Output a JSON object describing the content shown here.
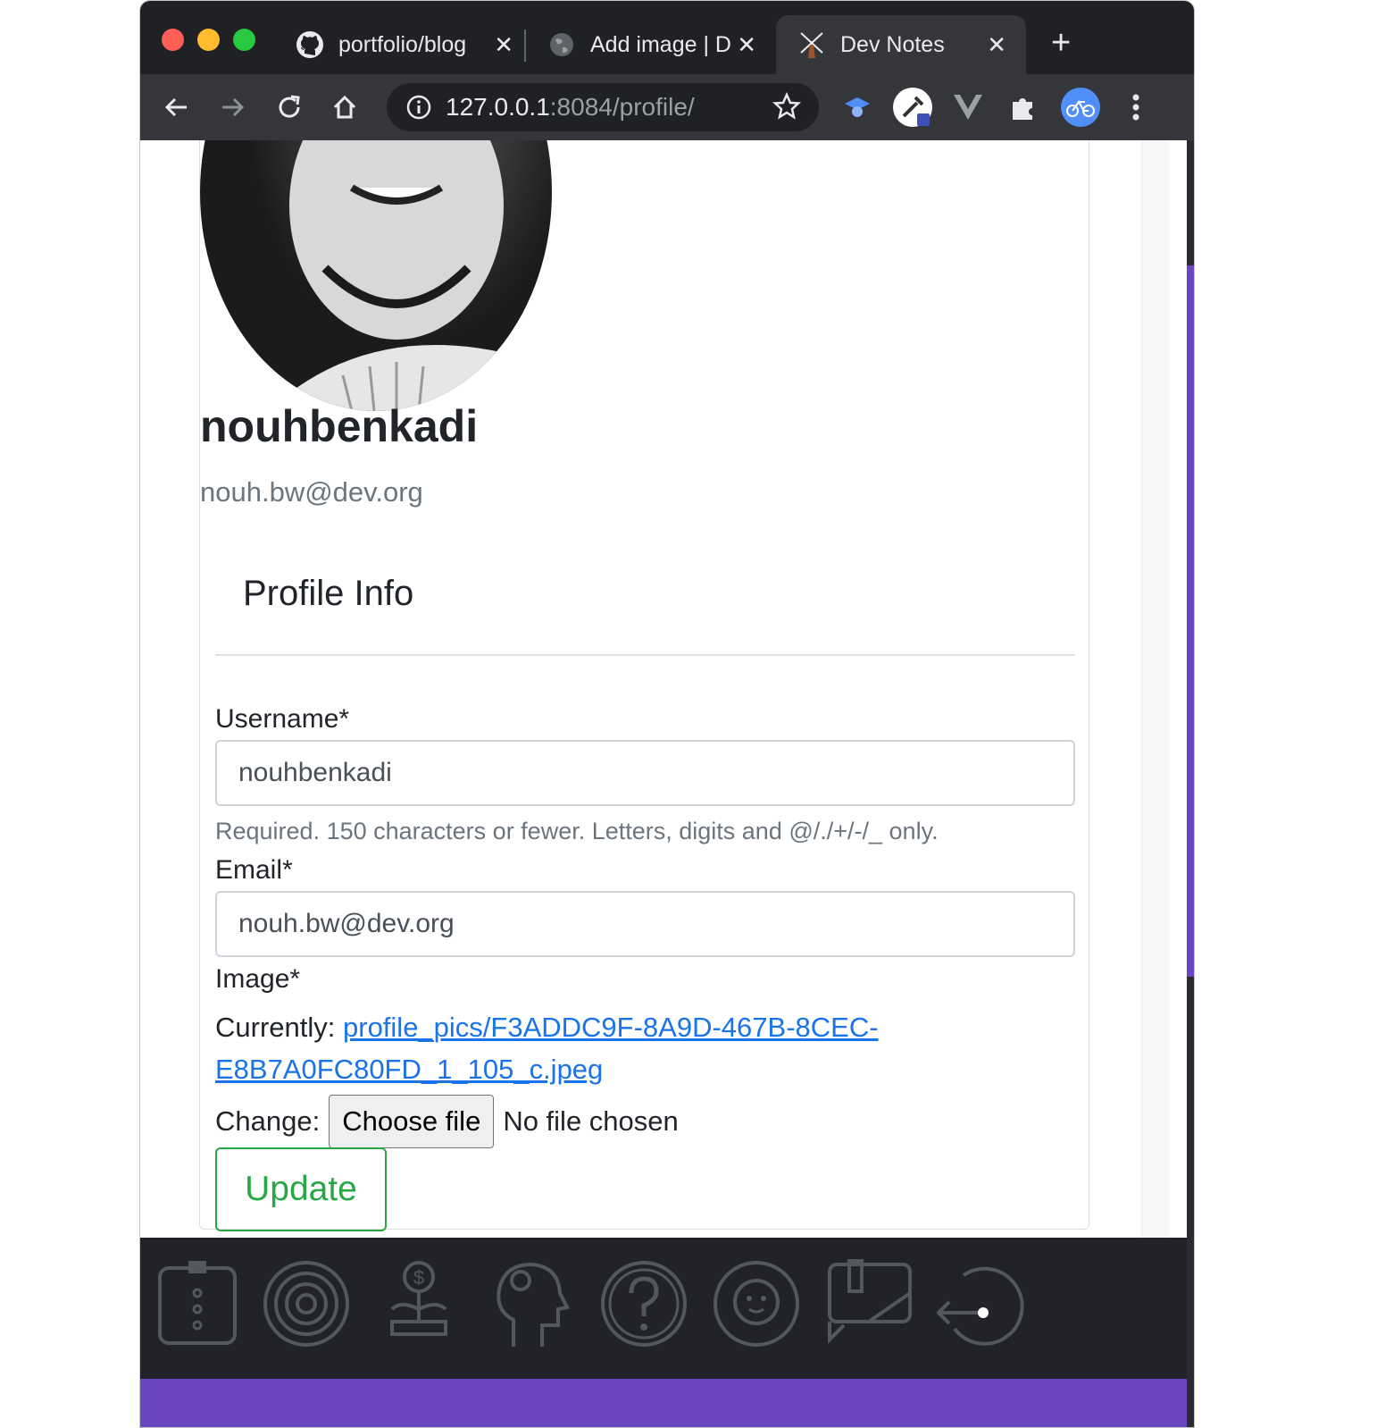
{
  "browser": {
    "tabs": [
      {
        "title": "portfolio/blog",
        "icon": "github-icon",
        "active": false
      },
      {
        "title": "Add image | D",
        "icon": "globe-icon",
        "active": false
      },
      {
        "title": "Dev Notes",
        "icon": "windmill-icon",
        "active": true
      }
    ],
    "url_host": "127.0.0.1",
    "url_rest": ":8084/profile/",
    "extensions": [
      "graduation-cap-icon",
      "eyedropper-icon",
      "vue-icon",
      "puzzle-icon",
      "bike-avatar-icon"
    ]
  },
  "profile": {
    "display_name": "nouhbenkadi",
    "email": "nouh.bw@dev.org"
  },
  "form": {
    "legend": "Profile Info",
    "username_label": "Username*",
    "username_value": "nouhbenkadi",
    "username_help": "Required. 150 characters or fewer. Letters, digits and @/./+/-/_ only.",
    "email_label": "Email*",
    "email_value": "nouh.bw@dev.org",
    "image_label": "Image*",
    "currently_label": "Currently:",
    "current_image_link": "profile_pics/F3ADDC9F-8A9D-467B-8CEC-E8B7A0FC80FD_1_105_c.jpeg",
    "change_label": "Change:",
    "choose_file_label": "Choose file",
    "no_file_text": "No file chosen",
    "update_label": "Update"
  },
  "colors": {
    "accent_green": "#28a745",
    "link_blue": "#1a73e8",
    "purple": "#6b46c1"
  },
  "bottom_icons": [
    "shirt-icon",
    "fingerprint-icon",
    "money-plant-icon",
    "gear-head-icon",
    "question-icon",
    "baby-face-icon",
    "notepad-icon",
    "logout-icon"
  ]
}
